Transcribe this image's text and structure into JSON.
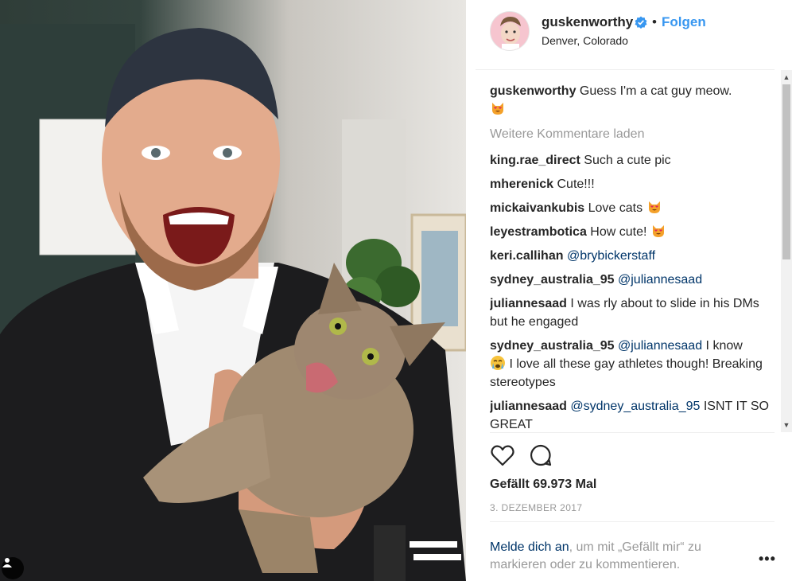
{
  "post": {
    "username": "guskenworthy",
    "dot": "•",
    "follow_label": "Folgen",
    "location": "Denver, Colorado",
    "caption": {
      "user": "guskenworthy",
      "text": "Guess I'm a cat guy meow."
    },
    "load_more": "Weitere Kommentare laden",
    "comments": [
      {
        "user": "king.rae_direct",
        "text": "Such a cute pic"
      },
      {
        "user": "mherenick",
        "text": "Cute!!!"
      },
      {
        "user": "mickaivankubis",
        "text": "Love cats"
      },
      {
        "user": "leyestrambotica",
        "text": "How cute!"
      },
      {
        "user": "keri.callihan",
        "mention": "@brybickerstaff"
      },
      {
        "user": "sydney_australia_95",
        "mention": "@juliannesaad"
      },
      {
        "user": "juliannesaad",
        "text": "I was rly about to slide in his DMs but he engaged"
      },
      {
        "user": "sydney_australia_95",
        "mention": "@juliannesaad",
        "text": "I know",
        "text2": "I love all these gay athletes though! Breaking stereotypes"
      },
      {
        "user": "juliannesaad",
        "mention": "@sydney_australia_95",
        "text": "ISNT IT SO GREAT"
      }
    ],
    "likes": "Gefällt 69.973 Mal",
    "date": "3. DEZEMBER 2017",
    "login": {
      "link": "Melde dich an",
      "rest": ", um mit „Gefällt mir“ zu markieren oder zu kommentieren."
    },
    "options": "•••",
    "icons": {
      "like": "heart-icon",
      "comment": "comment-icon",
      "verified": "verified-badge-icon",
      "tag": "user-tag-icon"
    },
    "colors": {
      "accent": "#3897f0",
      "link": "#003569",
      "muted": "#999999"
    }
  }
}
